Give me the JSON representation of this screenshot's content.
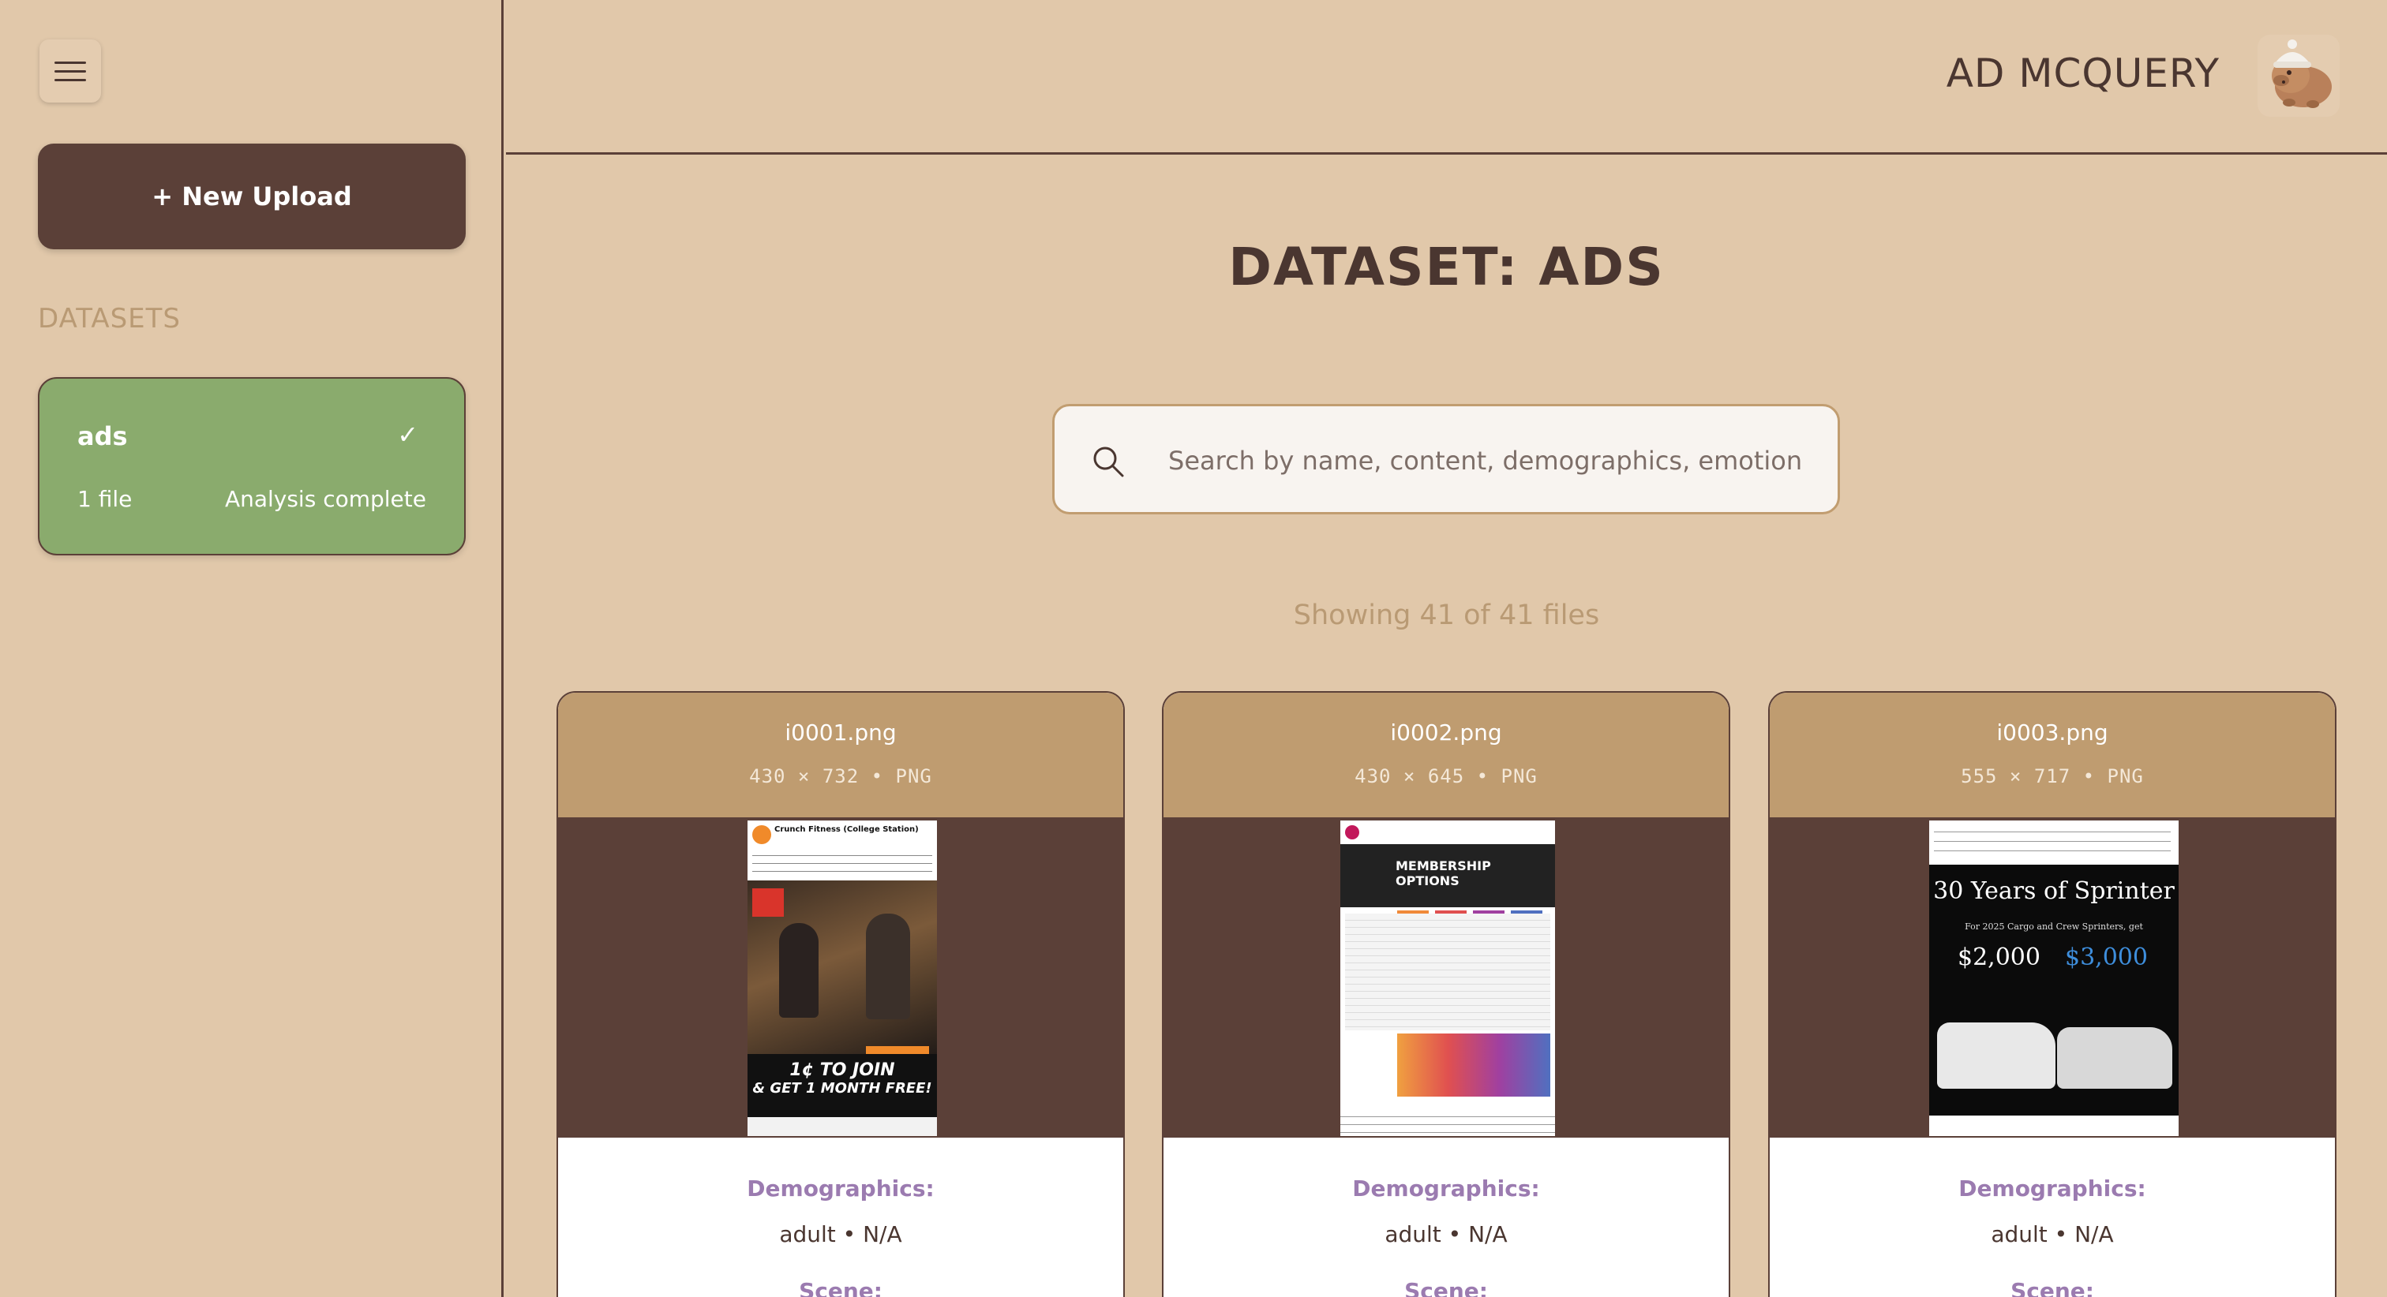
{
  "sidebar": {
    "new_upload_label": "+ New Upload",
    "datasets_heading": "DATASETS",
    "dataset": {
      "name": "ads",
      "check": "✓",
      "file_count": "1 file",
      "status": "Analysis complete"
    }
  },
  "header": {
    "brand": "AD MCQUERY"
  },
  "main": {
    "title": "DATASET: ADS",
    "search": {
      "placeholder": "Search by name, content, demographics, emotion",
      "value": ""
    },
    "showing": "Showing 41 of 41 files"
  },
  "cards": [
    {
      "filename": "i0001.png",
      "meta": "430 × 732 • PNG",
      "demographics_label": "Demographics:",
      "demographics_value": "adult • N/A",
      "scene_label": "Scene:",
      "thumb": {
        "advertiser": "Crunch Fitness (College Station)",
        "line1": "1¢ TO JOIN",
        "line2": "& GET 1 MONTH FREE!"
      }
    },
    {
      "filename": "i0002.png",
      "meta": "430 × 645 • PNG",
      "demographics_label": "Demographics:",
      "demographics_value": "adult • N/A",
      "scene_label": "Scene:",
      "thumb": {
        "headline": "MEMBERSHIP OPTIONS"
      }
    },
    {
      "filename": "i0003.png",
      "meta": "555 × 717 • PNG",
      "demographics_label": "Demographics:",
      "demographics_value": "adult • N/A",
      "scene_label": "Scene:",
      "thumb": {
        "headline": "30 Years of Sprinter",
        "offer": "For 2025 Cargo and Crew Sprinters, get",
        "amount1": "$2,000",
        "amount2": "$3,000"
      }
    }
  ],
  "colors": {
    "background": "#e1c8aa",
    "primary_dark": "#5b4038",
    "dataset_active": "#8aab6d",
    "card_header": "#bf9c70",
    "label_purple": "#9b7bb0",
    "muted_text": "#b99a74"
  },
  "icons": {
    "menu": "hamburger-menu-icon",
    "search": "search-icon",
    "avatar": "capybara-avatar-icon"
  }
}
